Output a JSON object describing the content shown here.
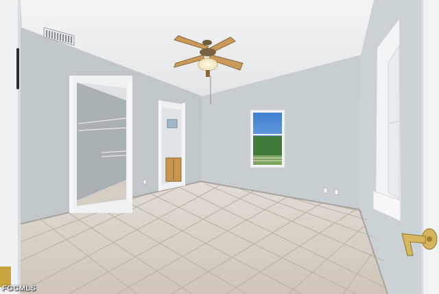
{
  "photo": {
    "subject": "empty-bedroom",
    "watermark": "FGCMLS"
  },
  "colors": {
    "ceiling": "#ecedee",
    "wall_left": "#c2cace",
    "wall_back": "#c8cfd3",
    "wall_right": "#ced5d9",
    "floor_tile": "#d7cfc6",
    "grout": "#b5ab9f",
    "fan_blade": "#c99a5a",
    "window_sky": "#4f8fd6",
    "cabinet": "#c8964e"
  }
}
